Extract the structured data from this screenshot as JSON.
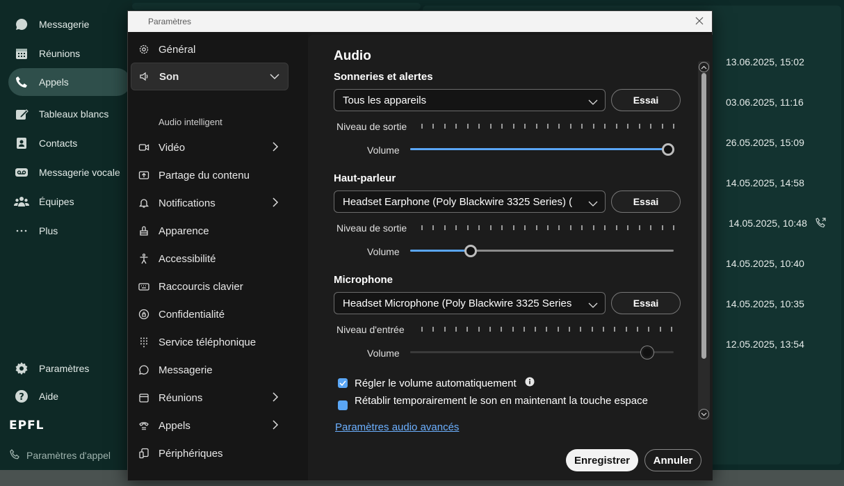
{
  "app": {
    "nav": [
      {
        "label": "Messagerie",
        "icon": "chat-bubble-icon"
      },
      {
        "label": "Réunions",
        "icon": "calendar-icon"
      },
      {
        "label": "Appels",
        "icon": "phone-icon"
      },
      {
        "label": "Tableaux blancs",
        "icon": "whiteboard-icon"
      },
      {
        "label": "Contacts",
        "icon": "contact-card-icon"
      },
      {
        "label": "Messagerie vocale",
        "icon": "voicemail-icon"
      },
      {
        "label": "Équipes",
        "icon": "people-icon"
      },
      {
        "label": "Plus",
        "icon": "more-icon"
      }
    ],
    "bottom_nav": [
      {
        "label": "Paramètres",
        "icon": "gear-icon"
      },
      {
        "label": "Aide",
        "icon": "help-icon"
      }
    ],
    "brand": "EPFL",
    "status_label": "Paramètres d'appel",
    "calls": [
      "13.06.2025, 15:02",
      "03.06.2025, 11:16",
      "26.05.2025, 15:09",
      "14.05.2025, 14:58",
      "14.05.2025, 10:48",
      "14.05.2025, 10:40",
      "14.05.2025, 10:35",
      "12.05.2025, 13:54"
    ]
  },
  "dialog": {
    "title": "Paramètres",
    "nav": [
      {
        "label": "Général",
        "icon": "gear-icon"
      },
      {
        "label": "Son",
        "icon": "speaker-icon"
      },
      {
        "label": "Vidéo",
        "icon": "video-camera-icon"
      },
      {
        "label": "Partage du contenu",
        "icon": "share-screen-icon"
      },
      {
        "label": "Notifications",
        "icon": "bell-icon"
      },
      {
        "label": "Apparence",
        "icon": "paint-bucket-icon"
      },
      {
        "label": "Accessibilité",
        "icon": "accessibility-icon"
      },
      {
        "label": "Raccourcis clavier",
        "icon": "keyboard-icon"
      },
      {
        "label": "Confidentialité",
        "icon": "privacy-icon"
      },
      {
        "label": "Service téléphonique",
        "icon": "dialpad-icon"
      },
      {
        "label": "Messagerie",
        "icon": "chat-bubble-icon"
      },
      {
        "label": "Réunions",
        "icon": "calendar-icon"
      },
      {
        "label": "Appels",
        "icon": "phone-icon"
      },
      {
        "label": "Périphériques",
        "icon": "devices-icon"
      }
    ],
    "sub_item": "Audio intelligent",
    "content": {
      "heading": "Audio",
      "ringtones": {
        "title": "Sonneries et alertes",
        "device": "Tous les appareils",
        "test_label": "Essai",
        "level_label": "Niveau de sortie",
        "volume_label": "Volume",
        "volume": 0.98
      },
      "speaker": {
        "title": "Haut-parleur",
        "device": "Headset Earphone (Poly Blackwire 3325 Series) (",
        "test_label": "Essai",
        "level_label": "Niveau de sortie",
        "volume_label": "Volume",
        "volume": 0.23
      },
      "microphone": {
        "title": "Microphone",
        "device": "Headset Microphone (Poly Blackwire 3325 Series",
        "test_label": "Essai",
        "level_label": "Niveau d'entrée",
        "volume_label": "Volume",
        "volume": 0.9
      },
      "auto_volume_label": "Régler le volume automatiquement",
      "space_unmute_label": "Rétablir temporairement le son en maintenant la touche espace",
      "advanced_link": "Paramètres audio avancés",
      "save_label": "Enregistrer",
      "cancel_label": "Annuler"
    }
  },
  "colors": {
    "accent": "#5aa6f5",
    "app_bg": "#0d2a28"
  }
}
